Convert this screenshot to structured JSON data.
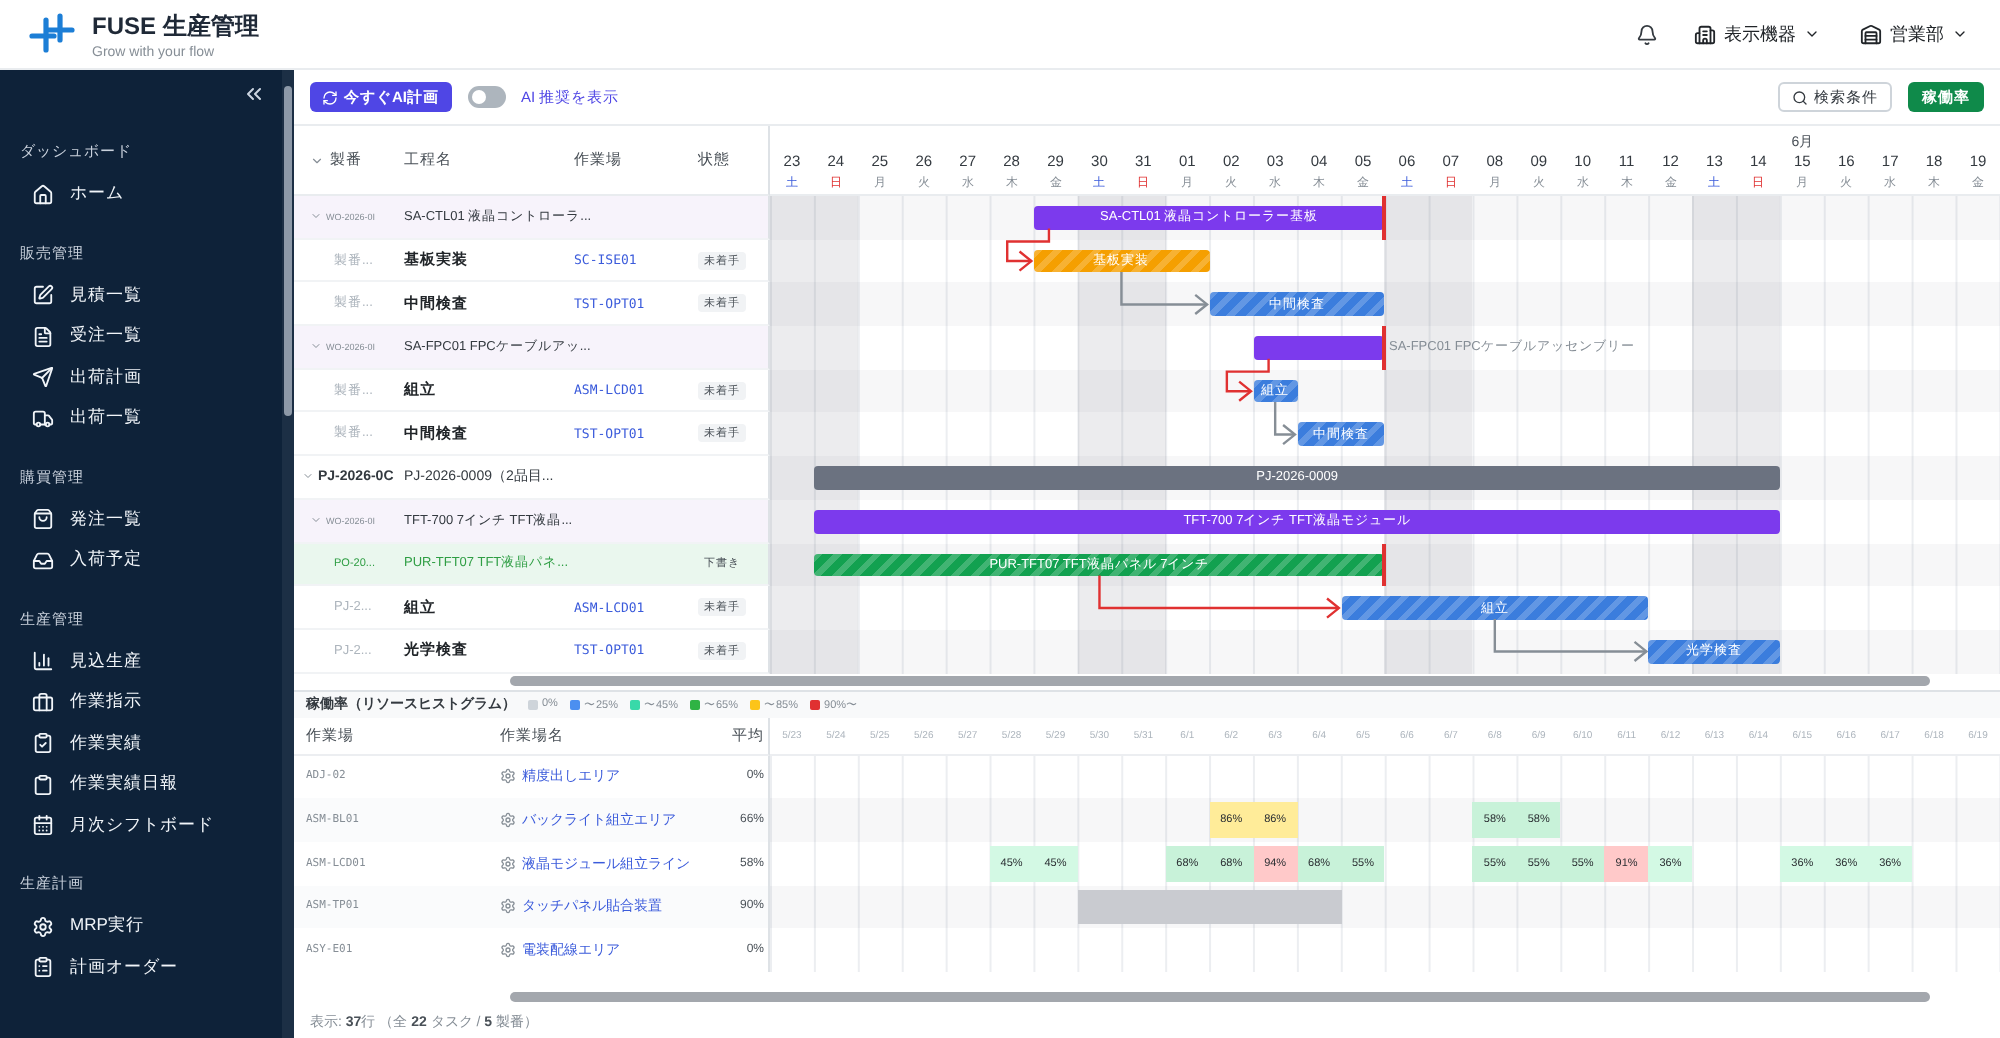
{
  "app": {
    "title": "FUSE 生産管理",
    "tagline": "Grow with your flow"
  },
  "header_menus": [
    {
      "label": "表示機器"
    },
    {
      "label": "営業部"
    }
  ],
  "sidebar": {
    "sections": [
      {
        "title": "ダッシュボード",
        "items": [
          {
            "label": "ホーム"
          }
        ]
      },
      {
        "title": "販売管理",
        "items": [
          {
            "label": "見積一覧"
          },
          {
            "label": "受注一覧"
          },
          {
            "label": "出荷計画"
          },
          {
            "label": "出荷一覧"
          }
        ]
      },
      {
        "title": "購買管理",
        "items": [
          {
            "label": "発注一覧"
          },
          {
            "label": "入荷予定"
          }
        ]
      },
      {
        "title": "生産管理",
        "items": [
          {
            "label": "見込生産"
          },
          {
            "label": "作業指示"
          },
          {
            "label": "作業実績"
          },
          {
            "label": "作業実績日報"
          },
          {
            "label": "月次シフトボード"
          }
        ]
      },
      {
        "title": "生産計画",
        "items": [
          {
            "label": "MRP実行"
          },
          {
            "label": "計画オーダー"
          }
        ]
      }
    ]
  },
  "toolbar": {
    "ai_plan_button": "今すぐAI計画",
    "ai_toggle": {
      "label": "AI 推奨を表示",
      "on": false
    },
    "search_button": "検索条件",
    "utilization_button": "稼働率"
  },
  "gantt": {
    "columns": [
      "製番",
      "工程名",
      "作業場",
      "状態"
    ],
    "days": [
      {
        "day": "23",
        "weekday": "土",
        "kind": "sat"
      },
      {
        "day": "24",
        "weekday": "日",
        "kind": "sun"
      },
      {
        "day": "25",
        "weekday": "月",
        "kind": "weekday"
      },
      {
        "day": "26",
        "weekday": "火",
        "kind": "weekday"
      },
      {
        "day": "27",
        "weekday": "水",
        "kind": "weekday"
      },
      {
        "day": "28",
        "weekday": "木",
        "kind": "weekday"
      },
      {
        "day": "29",
        "weekday": "金",
        "kind": "weekday"
      },
      {
        "day": "30",
        "weekday": "土",
        "kind": "sat"
      },
      {
        "day": "31",
        "weekday": "日",
        "kind": "sun"
      },
      {
        "day": "01",
        "weekday": "月",
        "kind": "weekday"
      },
      {
        "day": "02",
        "weekday": "火",
        "kind": "weekday"
      },
      {
        "day": "03",
        "weekday": "水",
        "kind": "weekday"
      },
      {
        "day": "04",
        "weekday": "木",
        "kind": "weekday"
      },
      {
        "day": "05",
        "weekday": "金",
        "kind": "weekday"
      },
      {
        "day": "06",
        "weekday": "土",
        "kind": "sat"
      },
      {
        "day": "07",
        "weekday": "日",
        "kind": "sun"
      },
      {
        "day": "08",
        "weekday": "月",
        "kind": "weekday"
      },
      {
        "day": "09",
        "weekday": "火",
        "kind": "weekday"
      },
      {
        "day": "10",
        "weekday": "水",
        "kind": "weekday"
      },
      {
        "day": "11",
        "weekday": "木",
        "kind": "weekday"
      },
      {
        "day": "12",
        "weekday": "金",
        "kind": "weekday"
      },
      {
        "day": "13",
        "weekday": "土",
        "kind": "sat"
      },
      {
        "day": "14",
        "weekday": "日",
        "kind": "sun"
      },
      {
        "day": "15",
        "weekday": "月",
        "kind": "weekday",
        "month": "6月"
      },
      {
        "day": "16",
        "weekday": "火",
        "kind": "weekday"
      },
      {
        "day": "17",
        "weekday": "水",
        "kind": "weekday"
      },
      {
        "day": "18",
        "weekday": "木",
        "kind": "weekday"
      },
      {
        "day": "19",
        "weekday": "金",
        "kind": "weekday"
      }
    ],
    "rows": [
      {
        "kind": "order",
        "expanded": true,
        "code": "WO-2026-0I",
        "name": "SA-CTL01 液晶コントローラ...",
        "bar": {
          "color": "#7c3aed",
          "striped": false,
          "label": "SA-CTL01 液晶コントローラー基板",
          "deadline": true
        }
      },
      {
        "kind": "task",
        "code": "製番...",
        "name": "基板実装",
        "workplace": "SC-ISE01",
        "status": "未着手",
        "bar": {
          "color": "#f59f00",
          "striped": true,
          "label": "基板実装",
          "linked": true,
          "critical": true
        }
      },
      {
        "kind": "task",
        "code": "製番...",
        "name": "中間検査",
        "workplace": "TST-OPT01",
        "status": "未着手",
        "bar": {
          "color": "#3b7ddd",
          "striped": true,
          "label": "中間検査",
          "linked": true,
          "critical": false
        }
      },
      {
        "kind": "order",
        "expanded": true,
        "code": "WO-2026-0I",
        "name": "SA-FPC01 FPCケーブルアッ...",
        "bar": {
          "color": "#7c3aed",
          "striped": false,
          "label": "SA-FPC01 FPCケーブルアッセンブリー",
          "label_outside": true,
          "deadline": true
        }
      },
      {
        "kind": "task",
        "code": "製番...",
        "name": "組立",
        "workplace": "ASM-LCD01",
        "status": "未着手",
        "bar": {
          "color": "#3b7ddd",
          "striped": true,
          "label": "組立",
          "linked": true,
          "critical": true
        }
      },
      {
        "kind": "task",
        "code": "製番...",
        "name": "中間検査",
        "workplace": "TST-OPT01",
        "status": "未着手",
        "bar": {
          "color": "#3b7ddd",
          "striped": true,
          "label": "中間検査",
          "linked": true,
          "critical": false
        }
      },
      {
        "kind": "project",
        "expanded": true,
        "code": "PJ-2026-0C",
        "name": "PJ-2026-0009（2品目...",
        "bar": {
          "color": "#6b7280",
          "striped": false,
          "label": "PJ-2026-0009"
        }
      },
      {
        "kind": "order",
        "expanded": true,
        "code": "WO-2026-0I",
        "name": "TFT-700 7インチ TFT液晶...",
        "bar": {
          "color": "#7c3aed",
          "striped": false,
          "label": "TFT-700 7インチ TFT液晶モジュール"
        }
      },
      {
        "kind": "purchase",
        "code": "PO-20...",
        "name": "PUR-TFT07 TFT液晶パネ...",
        "status": "下書き",
        "bar": {
          "color": "#12a150",
          "striped": true,
          "label": "PUR-TFT07 TFT液晶パネル 7インチ",
          "deadline": true
        }
      },
      {
        "kind": "task",
        "code": "PJ-2...",
        "name": "組立",
        "workplace": "ASM-LCD01",
        "status": "未着手",
        "bar": {
          "color": "#3b7ddd",
          "striped": true,
          "label": "組立",
          "linked": true,
          "critical": true
        }
      },
      {
        "kind": "task",
        "code": "PJ-2...",
        "name": "光学検査",
        "workplace": "TST-OPT01",
        "status": "未着手",
        "bar": {
          "color": "#3b7ddd",
          "striped": true,
          "label": "光学検査",
          "linked": true,
          "critical": false
        }
      }
    ]
  },
  "histogram": {
    "title": "稼働率（リソースヒストグラム）",
    "legend": [
      {
        "label": "0%",
        "color": "#ced4da"
      },
      {
        "label": "〜25%",
        "color": "#4c8ff0"
      },
      {
        "label": "〜45%",
        "color": "#38d9a9"
      },
      {
        "label": "〜65%",
        "color": "#2fb344"
      },
      {
        "label": "〜85%",
        "color": "#fcc419"
      },
      {
        "label": "90%〜",
        "color": "#e03131"
      }
    ],
    "columns": [
      "作業場",
      "作業場名",
      "平均"
    ],
    "dates": [
      "5/23",
      "5/24",
      "5/25",
      "5/26",
      "5/27",
      "5/28",
      "5/29",
      "5/30",
      "5/31",
      "6/1",
      "6/2",
      "6/3",
      "6/4",
      "6/5",
      "6/6",
      "6/7",
      "6/8",
      "6/9",
      "6/10",
      "6/11",
      "6/12",
      "6/13",
      "6/14",
      "6/15",
      "6/16",
      "6/17",
      "6/18",
      "6/19"
    ],
    "rows": [
      {
        "code": "ADJ-02",
        "name": "精度出しエリア",
        "average": "0%"
      },
      {
        "code": "ASM-BL01",
        "name": "バックライト組立エリア",
        "average": "66%",
        "cells": [
          {},
          {},
          {},
          {},
          {},
          {},
          {},
          {},
          {},
          {},
          {
            "text": "86%",
            "color": "#ffec99"
          },
          {
            "text": "86%",
            "color": "#ffec99"
          },
          {},
          {},
          {},
          {},
          {
            "text": "58%",
            "color": "#c8f2d9"
          },
          {
            "text": "58%",
            "color": "#c8f2d9"
          },
          {},
          {},
          {},
          {},
          {},
          {},
          {},
          {},
          {},
          {}
        ]
      },
      {
        "code": "ASM-LCD01",
        "name": "液晶モジュール組立ライン",
        "average": "58%",
        "cells": [
          {},
          {},
          {},
          {},
          {},
          {
            "text": "45%",
            "color": "#d3f9e4"
          },
          {
            "text": "45%",
            "color": "#d3f9e4"
          },
          {},
          {},
          {
            "text": "68%",
            "color": "#c8f2d9"
          },
          {
            "text": "68%",
            "color": "#c8f2d9"
          },
          {
            "text": "94%",
            "color": "#ffc9c9"
          },
          {
            "text": "68%",
            "color": "#c8f2d9"
          },
          {
            "text": "55%",
            "color": "#c8f2d9"
          },
          {},
          {},
          {
            "text": "55%",
            "color": "#c8f2d9"
          },
          {
            "text": "55%",
            "color": "#c8f2d9"
          },
          {
            "text": "55%",
            "color": "#c8f2d9"
          },
          {
            "text": "91%",
            "color": "#ffc9c9"
          },
          {
            "text": "36%",
            "color": "#d3f9e4"
          },
          {},
          {},
          {
            "text": "36%",
            "color": "#d3f9e4"
          },
          {
            "text": "36%",
            "color": "#d3f9e4"
          },
          {
            "text": "36%",
            "color": "#d3f9e4"
          },
          {},
          {}
        ]
      },
      {
        "code": "ASM-TP01",
        "name": "タッチパネル貼合装置",
        "average": "90%",
        "cells": [
          {},
          {},
          {},
          {},
          {},
          {},
          {},
          {
            "color": "#c9cbd0"
          },
          {
            "color": "#c9cbd0"
          },
          {
            "color": "#c9cbd0"
          },
          {
            "color": "#c9cbd0"
          },
          {
            "color": "#c9cbd0"
          },
          {
            "color": "#c9cbd0"
          },
          {},
          {},
          {},
          {},
          {},
          {},
          {},
          {},
          {},
          {},
          {},
          {},
          {},
          {},
          {}
        ]
      },
      {
        "code": "ASY-E01",
        "name": "電装配線エリア",
        "average": "0%"
      }
    ]
  },
  "footer": "表示: **37**行 （全 **22** タスク / **5** 製番）"
}
